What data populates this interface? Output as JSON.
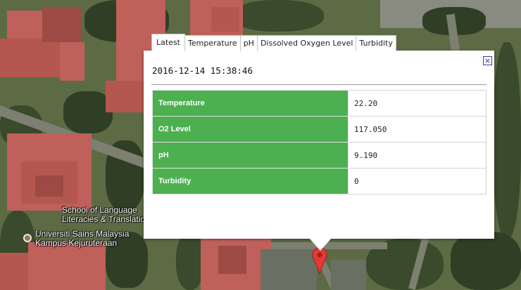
{
  "map": {
    "labels": {
      "school_line1": "School of Language",
      "school_line2": "Literacies & Translatio",
      "uni_line1": "Universiti Sains Malaysia",
      "uni_line2": "Kampus Kejuruteraan"
    },
    "icons": {
      "marker": "map-marker-icon",
      "place": "university-icon"
    },
    "colors": {
      "marker": "#e53935",
      "marker_dark": "#a31d1d"
    }
  },
  "infowindow": {
    "tabs": [
      {
        "label": "Latest",
        "active": true
      },
      {
        "label": "Temperature",
        "active": false
      },
      {
        "label": "pH",
        "active": false
      },
      {
        "label": "Dissolved Oxygen Level",
        "active": false
      },
      {
        "label": "Turbidity",
        "active": false
      }
    ],
    "close_icon": "close-icon",
    "close_glyph": "×",
    "timestamp": "2016-12-14 15:38:46",
    "readings": [
      {
        "label": "Temperature",
        "value": "22.20"
      },
      {
        "label": "O2 Level",
        "value": "117.050"
      },
      {
        "label": "pH",
        "value": "9.190"
      },
      {
        "label": "Turbidity",
        "value": "0"
      }
    ],
    "colors": {
      "label_bg": "#4caf50",
      "label_text": "#ffffff"
    }
  }
}
